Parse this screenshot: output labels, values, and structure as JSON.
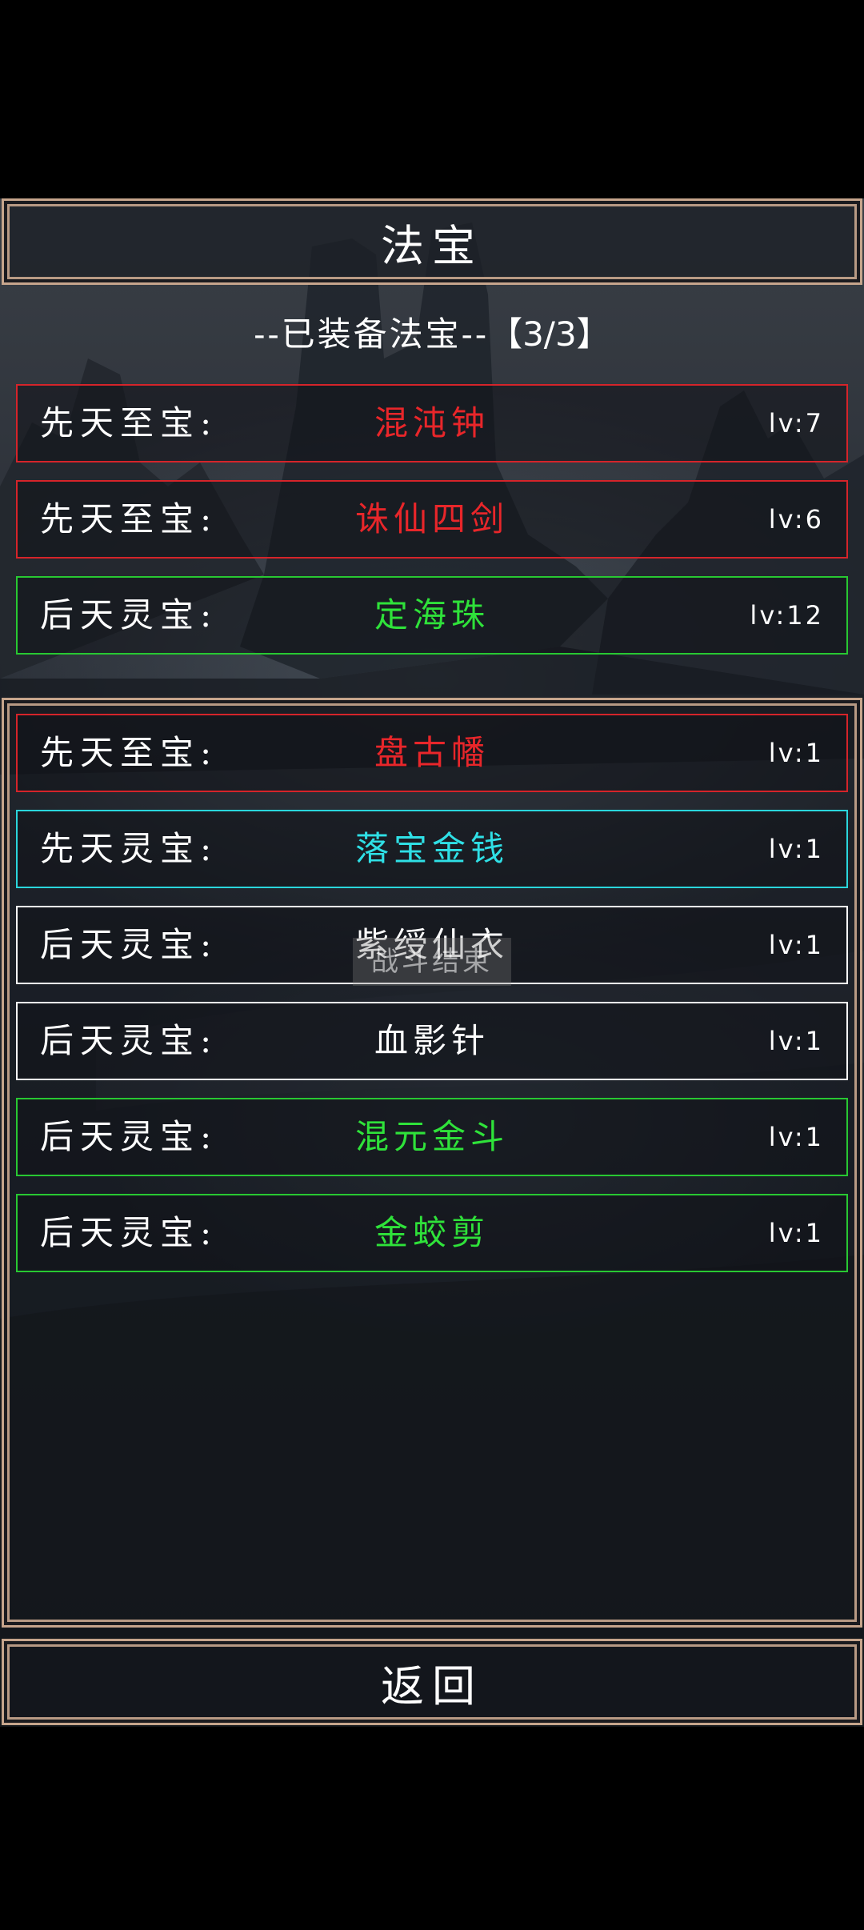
{
  "title": "法宝",
  "equipped": {
    "label": "--已装备法宝--",
    "count": "【3/3】",
    "items": [
      {
        "category": "先天至宝:",
        "name": "混沌钟",
        "level": "lv:7",
        "color": "#e8262a",
        "border": "#d5242a"
      },
      {
        "category": "先天至宝:",
        "name": "诛仙四剑",
        "level": "lv:6",
        "color": "#e8262a",
        "border": "#d5242a"
      },
      {
        "category": "后天灵宝:",
        "name": "定海珠",
        "level": "lv:12",
        "color": "#2fe23a",
        "border": "#28c832"
      }
    ]
  },
  "inventory": {
    "items": [
      {
        "category": "先天至宝:",
        "name": "盘古幡",
        "level": "lv:1",
        "color": "#e8262a",
        "border": "#d5242a"
      },
      {
        "category": "先天灵宝:",
        "name": "落宝金钱",
        "level": "lv:1",
        "color": "#2fe0e6",
        "border": "#2ad6dc"
      },
      {
        "category": "后天灵宝:",
        "name": "紫绶仙衣",
        "level": "lv:1",
        "color": "#ffffff",
        "border": "#ffffff"
      },
      {
        "category": "后天灵宝:",
        "name": "血影针",
        "level": "lv:1",
        "color": "#ffffff",
        "border": "#ffffff"
      },
      {
        "category": "后天灵宝:",
        "name": "混元金斗",
        "level": "lv:1",
        "color": "#2fe23a",
        "border": "#28c832"
      },
      {
        "category": "后天灵宝:",
        "name": "金蛟剪",
        "level": "lv:1",
        "color": "#2fe23a",
        "border": "#28c832"
      }
    ]
  },
  "toast": "战斗结束",
  "back_label": "返回"
}
